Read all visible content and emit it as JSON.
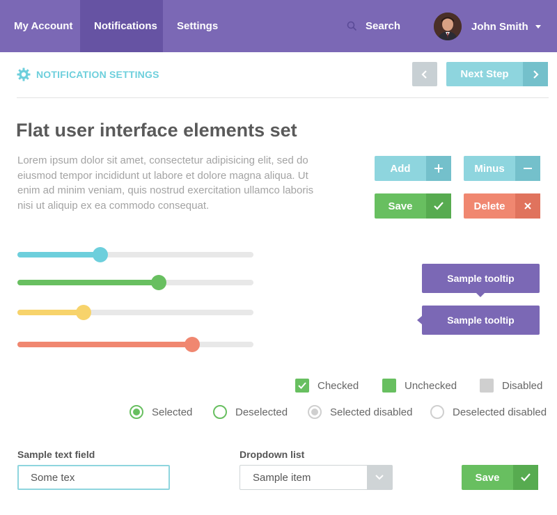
{
  "nav": {
    "items": [
      {
        "label": "My Account"
      },
      {
        "label": "Notifications"
      },
      {
        "label": "Settings"
      }
    ],
    "active_index": 1,
    "search_label": "Search",
    "user_name": "John Smith",
    "icons": {
      "search": "search-icon",
      "avatar": "user-avatar",
      "dropdown": "caret-down-icon"
    }
  },
  "subheader": {
    "title": "NOTIFICATION SETTINGS",
    "icon": "gear-icon",
    "prev_icon": "chevron-left-icon",
    "next_label": "Next Step",
    "next_icon": "chevron-right-icon"
  },
  "main": {
    "title": "Flat user interface elements set",
    "body": "Lorem ipsum dolor sit amet, consectetur adipisicing elit, sed do eiusmod tempor incididunt ut labore et dolore magna aliqua. Ut enim ad minim veniam, quis nostrud exercitation ullamco laboris nisi ut aliquip ex ea commodo consequat."
  },
  "buttons": {
    "add": "Add",
    "minus": "Minus",
    "save": "Save",
    "delete": "Delete"
  },
  "sliders": [
    {
      "name": "slider-blue",
      "value": 0.35,
      "color": "#6dcfdc"
    },
    {
      "name": "slider-green",
      "value": 0.6,
      "color": "#68bf60"
    },
    {
      "name": "slider-yellow",
      "value": 0.28,
      "color": "#f7d36b"
    },
    {
      "name": "slider-red",
      "value": 0.74,
      "color": "#f08770"
    }
  ],
  "tooltips": [
    "Sample tooltip",
    "Sample tooltip"
  ],
  "checkboxes": [
    {
      "label": "Checked",
      "state": "checked"
    },
    {
      "label": "Unchecked",
      "state": "unchecked"
    },
    {
      "label": "Disabled",
      "state": "disabled"
    }
  ],
  "radios": [
    {
      "label": "Selected",
      "state": "selected"
    },
    {
      "label": "Deselected",
      "state": "deselected"
    },
    {
      "label": "Selected disabled",
      "state": "selected-disabled"
    },
    {
      "label": "Deselected disabled",
      "state": "deselected-disabled"
    }
  ],
  "form": {
    "text_label": "Sample text field",
    "text_value": "Some tex",
    "dropdown_label": "Dropdown list",
    "dropdown_value": "Sample item",
    "save_label": "Save"
  },
  "colors": {
    "purple": "#7b68b5",
    "purple_active": "#6653a3",
    "teal": "#8ed5de",
    "green": "#68bf60",
    "red": "#f08770",
    "yellow": "#f7d36b"
  }
}
